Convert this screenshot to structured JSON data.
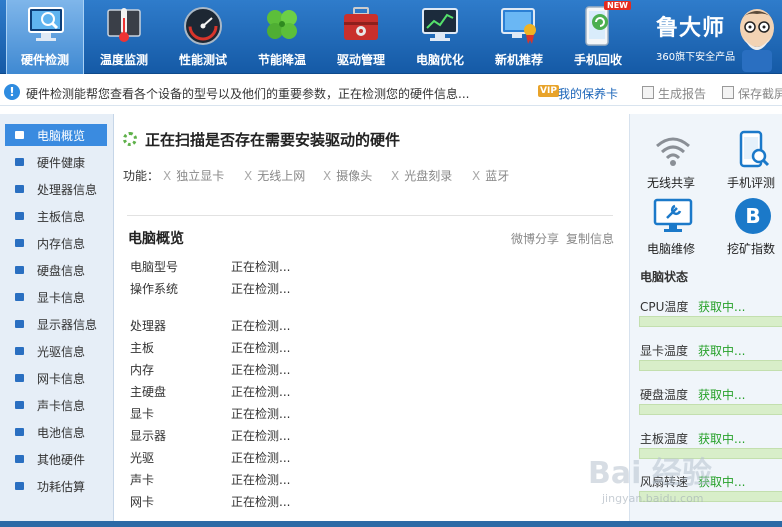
{
  "toolbar": {
    "items": [
      {
        "label": "硬件检测",
        "icon": "monitor-magnifier-icon",
        "active": true
      },
      {
        "label": "温度监测",
        "icon": "thermometer-icon"
      },
      {
        "label": "性能测试",
        "icon": "speedometer-icon"
      },
      {
        "label": "节能降温",
        "icon": "clover-icon"
      },
      {
        "label": "驱动管理",
        "icon": "toolbox-icon"
      },
      {
        "label": "电脑优化",
        "icon": "monitor-chart-icon"
      },
      {
        "label": "新机推荐",
        "icon": "award-monitor-icon"
      },
      {
        "label": "手机回收",
        "icon": "phone-recycle-icon",
        "badge": "NEW"
      }
    ]
  },
  "brand": {
    "name": "鲁大师",
    "subtitle": "360旗下安全产品",
    "avatar_icon": "ludashi-mascot-icon"
  },
  "infobar": {
    "icon": "info-icon",
    "text": "硬件检测能帮您查看各个设备的型号以及他们的重要参数，正在检测您的硬件信息...",
    "vip_badge": "VIP",
    "vip_link": "我的保养卡",
    "report": "生成报告",
    "save": "保存截屏"
  },
  "sidebar": {
    "items": [
      {
        "label": "电脑概览",
        "active": true
      },
      {
        "label": "硬件健康"
      },
      {
        "label": "处理器信息"
      },
      {
        "label": "主板信息"
      },
      {
        "label": "内存信息"
      },
      {
        "label": "硬盘信息"
      },
      {
        "label": "显卡信息"
      },
      {
        "label": "显示器信息"
      },
      {
        "label": "光驱信息"
      },
      {
        "label": "网卡信息"
      },
      {
        "label": "声卡信息"
      },
      {
        "label": "电池信息"
      },
      {
        "label": "其他硬件"
      },
      {
        "label": "功耗估算"
      }
    ]
  },
  "main": {
    "scan_title": "正在扫描是否存在需要安装驱动的硬件",
    "func_label": "功能：",
    "functions": [
      "独立显卡",
      "无线上网",
      "摄像头",
      "光盘刻录",
      "蓝牙"
    ],
    "overview_title": "电脑概览",
    "weibo_share": "微博分享",
    "copy_info": "复制信息",
    "group1": [
      {
        "label": "电脑型号",
        "value": "正在检测..."
      },
      {
        "label": "操作系统",
        "value": "正在检测..."
      }
    ],
    "group2": [
      {
        "label": "处理器",
        "value": "正在检测..."
      },
      {
        "label": "主板",
        "value": "正在检测..."
      },
      {
        "label": "内存",
        "value": "正在检测..."
      },
      {
        "label": "主硬盘",
        "value": "正在检测..."
      },
      {
        "label": "显卡",
        "value": "正在检测..."
      },
      {
        "label": "显示器",
        "value": "正在检测..."
      },
      {
        "label": "光驱",
        "value": "正在检测..."
      },
      {
        "label": "声卡",
        "value": "正在检测..."
      },
      {
        "label": "网卡",
        "value": "正在检测..."
      }
    ]
  },
  "right": {
    "tools": [
      {
        "label": "无线共享",
        "icon": "wifi-icon"
      },
      {
        "label": "手机评测",
        "icon": "phone-scan-icon"
      },
      {
        "label": "电脑维修",
        "icon": "monitor-wrench-icon"
      },
      {
        "label": "挖矿指数",
        "icon": "bitcoin-icon"
      }
    ],
    "status_title": "电脑状态",
    "stats": [
      {
        "label": "CPU温度",
        "value": "获取中..."
      },
      {
        "label": "显卡温度",
        "value": "获取中..."
      },
      {
        "label": "硬盘温度",
        "value": "获取中..."
      },
      {
        "label": "主板温度",
        "value": "获取中..."
      },
      {
        "label": "风扇转速",
        "value": "获取中..."
      }
    ]
  },
  "watermark": {
    "main": "Bai 经验",
    "sub": "jingyan.baidu.com"
  },
  "colors": {
    "toolbar": "#1f6bb8",
    "active_sidebar": "#3a8be0",
    "status_green": "#27a12a"
  }
}
